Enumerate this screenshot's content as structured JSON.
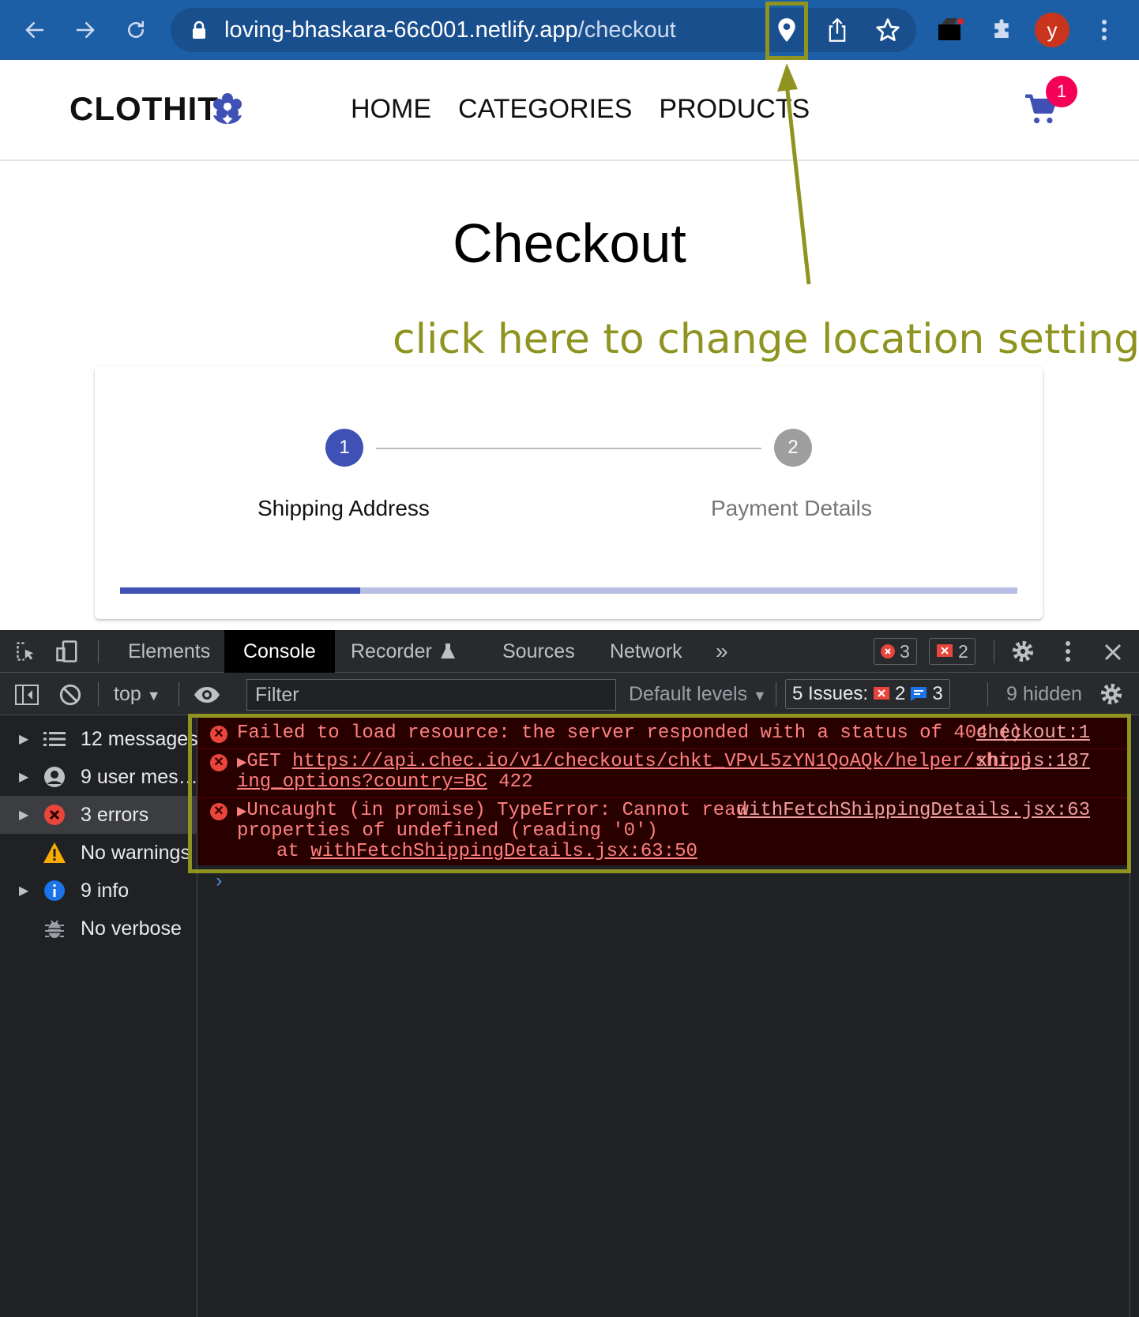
{
  "browser": {
    "url_host": "loving-bhaskara-66c001.netlify.app",
    "url_path": "/checkout",
    "avatar_letter": "y",
    "icons": [
      "back-arrow-icon",
      "forward-arrow-icon",
      "reload-icon",
      "lock-icon",
      "location-pin-icon",
      "share-icon",
      "star-icon",
      "extension-puzzle-icon",
      "kebab-menu-icon"
    ]
  },
  "site": {
    "logo": "CLOTHIT",
    "nav": [
      "HOME",
      "CATEGORIES",
      "PRODUCTS"
    ],
    "cart_count": "1"
  },
  "checkout": {
    "title": "Checkout",
    "steps": [
      {
        "number": "1",
        "label": "Shipping Address",
        "active": true
      },
      {
        "number": "2",
        "label": "Payment Details",
        "active": false
      }
    ],
    "progress_fraction": 0.268
  },
  "annotation": {
    "text": "click here to change location settings",
    "color": "#8f9420"
  },
  "devtools": {
    "tabs": [
      "Elements",
      "Console",
      "Recorder",
      "Sources",
      "Network"
    ],
    "active_tab": "Console",
    "error_count": "3",
    "issue_count_badge": "2",
    "context": "top",
    "filter_placeholder": "Filter",
    "default_levels": "Default levels",
    "issues_label": "5 Issues:",
    "issues_errors": "2",
    "issues_info": "3",
    "hidden": "9 hidden",
    "sidebar": [
      {
        "label": "12 messages",
        "icon": "list-icon"
      },
      {
        "label": "9 user mes…",
        "icon": "user-icon"
      },
      {
        "label": "3 errors",
        "icon": "error-icon"
      },
      {
        "label": "No warnings",
        "icon": "warning-icon"
      },
      {
        "label": "9 info",
        "icon": "info-icon"
      },
      {
        "label": "No verbose",
        "icon": "bug-icon"
      }
    ],
    "messages": [
      {
        "text": "Failed to load resource: the server responded with a status of 404 ()",
        "source": "checkout:1"
      },
      {
        "method": "GET",
        "url_line1": "https://api.chec.io/v1/checkouts/chkt_VPvL5zYN1QoAQk/helper/shipp",
        "url_line2": "ing_options?country=BC",
        "status": "422",
        "source": "xhr.js:187"
      },
      {
        "line1": "Uncaught (in promise) TypeError: Cannot read",
        "line2": "properties of undefined (reading '0')",
        "line3_prefix": "at",
        "line3_link": "withFetchShippingDetails.jsx:63:50",
        "source": "withFetchShippingDetails.jsx:63"
      }
    ],
    "colors": {
      "error_text": "#ff8080",
      "error_bg": "#290000",
      "accent": "#3f51b5"
    }
  }
}
